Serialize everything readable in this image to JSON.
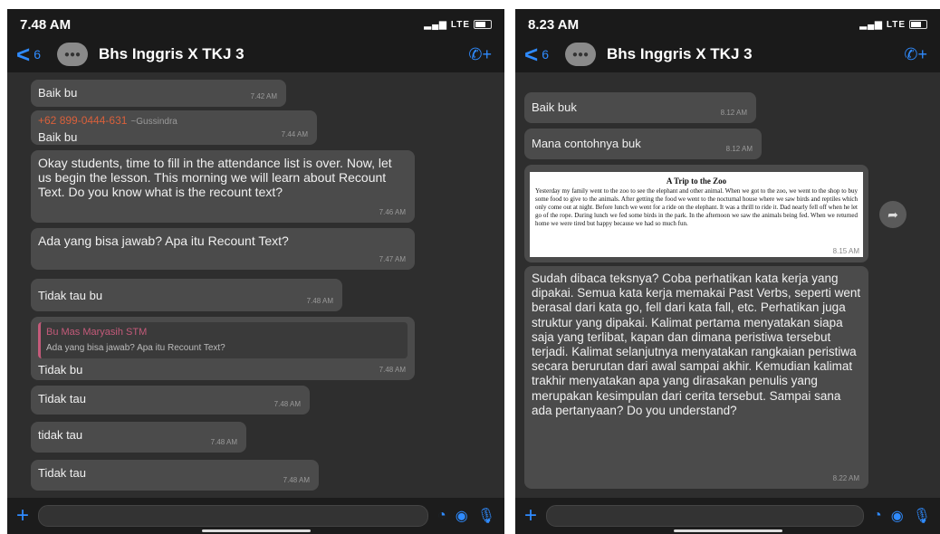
{
  "left": {
    "status": {
      "time": "7.48 AM",
      "network": "LTE"
    },
    "header": {
      "back_count": "6",
      "title": "Bhs Inggris X TKJ 3"
    },
    "messages": [
      {
        "text": "Baik bu",
        "time": "7.42 AM"
      },
      {
        "sender": "+62 899-0444-631",
        "sender_name": "~Gussindra",
        "text": "Baik bu",
        "time": "7.44 AM"
      },
      {
        "text": "Okay students, time to fill in the attendance list is over. Now, let us begin the lesson. This morning we will learn about Recount Text. Do you know what is the recount text?",
        "time": "7.46 AM"
      },
      {
        "text": "Ada yang bisa jawab? Apa itu Recount Text?",
        "time": "7.47 AM"
      },
      {
        "text": "Tidak tau bu",
        "time": "7.48 AM"
      },
      {
        "quote_name": "Bu Mas Maryasih STM",
        "quote_text": "Ada yang bisa jawab? Apa itu Recount Text?",
        "text": "Tidak bu",
        "time": "7.48 AM"
      },
      {
        "text": "Tidak tau",
        "time": "7.48 AM"
      },
      {
        "text": "tidak tau",
        "time": "7.48 AM"
      },
      {
        "text": "Tidak tau",
        "time": "7.48 AM"
      }
    ]
  },
  "right": {
    "status": {
      "time": "8.23 AM",
      "network": "LTE"
    },
    "header": {
      "back_count": "6",
      "title": "Bhs Inggris X TKJ 3"
    },
    "messages": [
      {
        "text": "Baik buk",
        "time": "8.12 AM"
      },
      {
        "text": "Mana contohnya buk",
        "time": "8.12 AM"
      },
      {
        "doc_title": "A Trip to the Zoo",
        "doc_body": "Yesterday my family went to the zoo to see the elephant and other animal. When we got to the zoo, we went to the shop to buy some food to give to the animals. After getting the food we went to the nocturnal house where we saw birds and reptiles which only come out at night. Before lunch we went for a ride on the elephant. It was a thrill to ride it. Dad nearly fell off when he let go of the rope. During lunch we fed some birds in the park. In the afternoon we saw the animals being fed. When we returned home we were tired but happy because we had so much fun.",
        "time": "8.15 AM"
      },
      {
        "text": "Sudah dibaca teksnya? Coba perhatikan kata kerja yang dipakai. Semua kata kerja memakai Past Verbs, seperti went berasal dari kata go, fell dari kata fall, etc. Perhatikan juga struktur yang dipakai. Kalimat pertama menyatakan siapa saja yang terlibat, kapan dan dimana peristiwa tersebut terjadi. Kalimat selanjutnya menyatakan rangkaian peristiwa secara berurutan dari awal sampai akhir. Kemudian kalimat trakhir menyatakan apa yang dirasakan penulis yang merupakan kesimpulan dari cerita tersebut. Sampai sana ada pertanyaan? Do you understand?",
        "time": "8.22 AM"
      }
    ]
  }
}
